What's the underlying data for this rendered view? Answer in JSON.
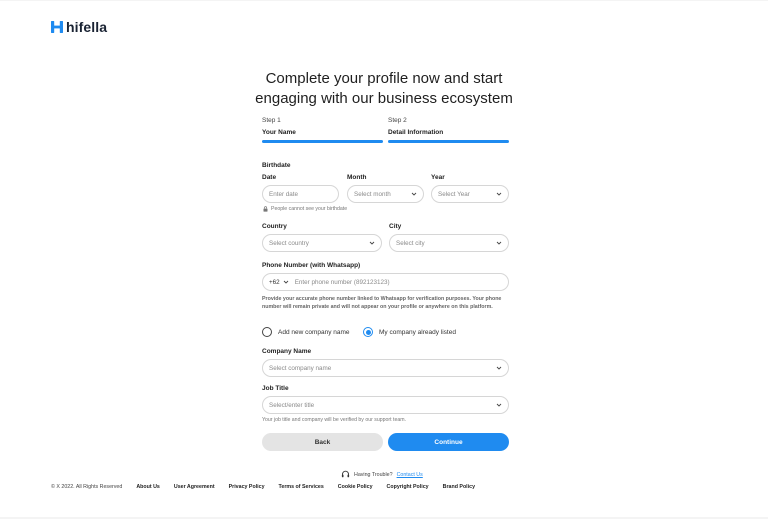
{
  "brand": {
    "name": "hifella",
    "color": "#1f8bf0"
  },
  "heading": {
    "line1": "Complete your profile now and start",
    "line2": "engaging with our business ecosystem"
  },
  "steps": [
    {
      "number": "Step 1",
      "name": "Your Name",
      "completed": true
    },
    {
      "number": "Step 2",
      "name": "Detail Information",
      "completed": true
    }
  ],
  "birthdate": {
    "section_label": "Birthdate",
    "date": {
      "label": "Date",
      "placeholder": "Enter date"
    },
    "month": {
      "label": "Month",
      "placeholder": "Select month"
    },
    "year": {
      "label": "Year",
      "placeholder": "Select Year"
    },
    "privacy_note": "People cannot see your birthdate"
  },
  "country": {
    "label": "Country",
    "placeholder": "Select country"
  },
  "city": {
    "label": "City",
    "placeholder": "Select city"
  },
  "phone": {
    "label": "Phone Number (with Whatsapp)",
    "country_code": "+62",
    "placeholder": "Enter phone number (892123123)",
    "help": "Provide your accurate phone number linked to Whatsapp for verification purposes. Your phone number will remain private and will not appear on your profile or anywhere on this platform."
  },
  "company_choice": {
    "option_new": "Add new company name",
    "option_listed": "My company already listed",
    "selected": "option_listed"
  },
  "company": {
    "label": "Company Name",
    "placeholder": "Select company name"
  },
  "job": {
    "label": "Job Title",
    "placeholder": "Select/enter title",
    "note": "Your job title and company will be verified by our support team."
  },
  "buttons": {
    "back": "Back",
    "continue": "Continue"
  },
  "help_line": {
    "text": "Having Trouble?",
    "link": "Contact Us"
  },
  "footer": {
    "copyright": "© X 2022. All Rights Reserved",
    "links": [
      "About Us",
      "User Agreement",
      "Privacy Policy",
      "Terms of Services",
      "Cookie Policy",
      "Copyright Policy",
      "Brand Policy"
    ]
  }
}
